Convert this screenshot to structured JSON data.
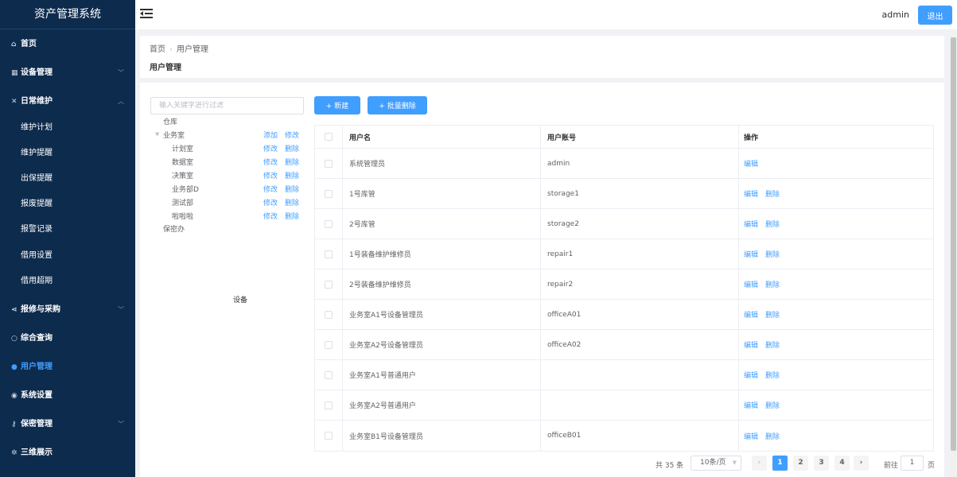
{
  "app_title": "资产管理系统",
  "header": {
    "user": "admin",
    "logout_label": "退出"
  },
  "sidebar": {
    "items": [
      {
        "label": "首页",
        "icon": "home-icon",
        "glyph": "⌂",
        "chevron": ""
      },
      {
        "label": "设备管理",
        "icon": "grid-icon",
        "glyph": "▦",
        "chevron": "﹀"
      },
      {
        "label": "日常维护",
        "icon": "tools-icon",
        "glyph": "✕",
        "chevron": "︿"
      },
      {
        "label": "维护计划",
        "icon": "",
        "glyph": "",
        "chevron": ""
      },
      {
        "label": "维护提醒",
        "icon": "",
        "glyph": "",
        "chevron": ""
      },
      {
        "label": "出保提醒",
        "icon": "",
        "glyph": "",
        "chevron": ""
      },
      {
        "label": "报废提醒",
        "icon": "",
        "glyph": "",
        "chevron": ""
      },
      {
        "label": "报警记录",
        "icon": "",
        "glyph": "",
        "chevron": ""
      },
      {
        "label": "借用设置",
        "icon": "",
        "glyph": "",
        "chevron": ""
      },
      {
        "label": "借用超期",
        "icon": "",
        "glyph": "",
        "chevron": ""
      },
      {
        "label": "报修与采购",
        "icon": "share-icon",
        "glyph": "⋖",
        "chevron": "﹀"
      },
      {
        "label": "综合查询",
        "icon": "search-icon",
        "glyph": "○",
        "chevron": ""
      },
      {
        "label": "用户管理",
        "icon": "users-icon",
        "glyph": "●",
        "chevron": ""
      },
      {
        "label": "系统设置",
        "icon": "settings-icon",
        "glyph": "◉",
        "chevron": ""
      },
      {
        "label": "保密管理",
        "icon": "key-icon",
        "glyph": "⚷",
        "chevron": "﹀"
      },
      {
        "label": "三维展示",
        "icon": "gear-icon",
        "glyph": "✲",
        "chevron": ""
      }
    ]
  },
  "breadcrumb": {
    "home": "首页",
    "separator": "›",
    "current": "用户管理"
  },
  "page_title": "用户管理",
  "tree": {
    "filter_placeholder": "输入关键字进行过滤",
    "footer": "设备",
    "nodes": [
      {
        "label": "仓库",
        "actions": []
      },
      {
        "label": "业务室",
        "arrow": "▼",
        "actions": [
          "添加",
          "修改"
        ]
      },
      {
        "label": "计划室",
        "actions": [
          "修改",
          "删除"
        ]
      },
      {
        "label": "数据室",
        "actions": [
          "修改",
          "删除"
        ]
      },
      {
        "label": "决策室",
        "actions": [
          "修改",
          "删除"
        ]
      },
      {
        "label": "业务部D",
        "actions": [
          "修改",
          "删除"
        ]
      },
      {
        "label": "测试部",
        "actions": [
          "修改",
          "删除"
        ]
      },
      {
        "label": "啦啦啦",
        "actions": [
          "修改",
          "删除"
        ]
      },
      {
        "label": "保密办",
        "actions": []
      }
    ]
  },
  "toolbar": {
    "new_label": "+ 新建",
    "batch_delete_label": "+ 批量删除"
  },
  "table": {
    "columns": [
      "用户名",
      "用户账号",
      "操作"
    ],
    "rows": [
      {
        "name": "系统管理员",
        "account": "admin",
        "ops": [
          "编辑"
        ]
      },
      {
        "name": "1号库管",
        "account": "storage1",
        "ops": [
          "编辑",
          "删除"
        ]
      },
      {
        "name": "2号库管",
        "account": "storage2",
        "ops": [
          "编辑",
          "删除"
        ]
      },
      {
        "name": "1号装备维护维修员",
        "account": "repair1",
        "ops": [
          "编辑",
          "删除"
        ]
      },
      {
        "name": "2号装备维护维修员",
        "account": "repair2",
        "ops": [
          "编辑",
          "删除"
        ]
      },
      {
        "name": "业务室A1号设备管理员",
        "account": "officeA01",
        "ops": [
          "编辑",
          "删除"
        ]
      },
      {
        "name": "业务室A2号设备管理员",
        "account": "officeA02",
        "ops": [
          "编辑",
          "删除"
        ]
      },
      {
        "name": "业务室A1号普通用户",
        "account": "",
        "ops": [
          "编辑",
          "删除"
        ]
      },
      {
        "name": "业务室A2号普通用户",
        "account": "",
        "ops": [
          "编辑",
          "删除"
        ]
      },
      {
        "name": "业务室B1号设备管理员",
        "account": "officeB01",
        "ops": [
          "编辑",
          "删除"
        ]
      }
    ]
  },
  "pagination": {
    "total": "共 35 条",
    "page_size": "10条/页",
    "prev": "‹",
    "next": "›",
    "pages": [
      "1",
      "2",
      "3",
      "4"
    ],
    "current_page": "1",
    "goto_label": "前往",
    "goto_value": "1",
    "goto_unit": "页"
  },
  "colors": {
    "sidebar_bg": "#0d2b4d",
    "accent": "#409eff",
    "page_bg": "#f0f2f5"
  }
}
